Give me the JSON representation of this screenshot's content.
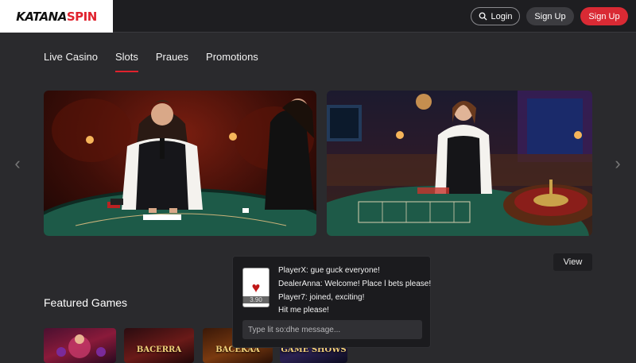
{
  "brand": {
    "part1": "KATANA",
    "part2": "SPIN"
  },
  "header": {
    "login_label": "Login",
    "signup_label_1": "Sign Up",
    "signup_label_2": "Sign Up"
  },
  "nav": {
    "items": [
      {
        "label": "Live Casino"
      },
      {
        "label": "Slots"
      },
      {
        "label": "Praues"
      },
      {
        "label": "Promotions"
      }
    ],
    "active": "Slots"
  },
  "carousel": {
    "prev_icon": "chevron-left-icon",
    "next_icon": "chevron-right-icon"
  },
  "view_button": "View",
  "featured": {
    "title": "Featured Games",
    "tiles": [
      {
        "label": ""
      },
      {
        "label": "BACERRA"
      },
      {
        "label": "BACEKAA"
      },
      {
        "label": "GAME SHOWS"
      }
    ]
  },
  "chat": {
    "card_amount": "3.90",
    "messages": [
      "PlayerX: gue guck everyone!",
      "DealerAnna: Welcome! Place l bets please!",
      "Player7: joined, exciting!",
      "Hit me please!"
    ],
    "input_placeholder": "Type lit so:dhe message..."
  },
  "colors": {
    "accent": "#e0222d",
    "background": "#2a2a2d",
    "header_bg": "#1e1e21"
  }
}
